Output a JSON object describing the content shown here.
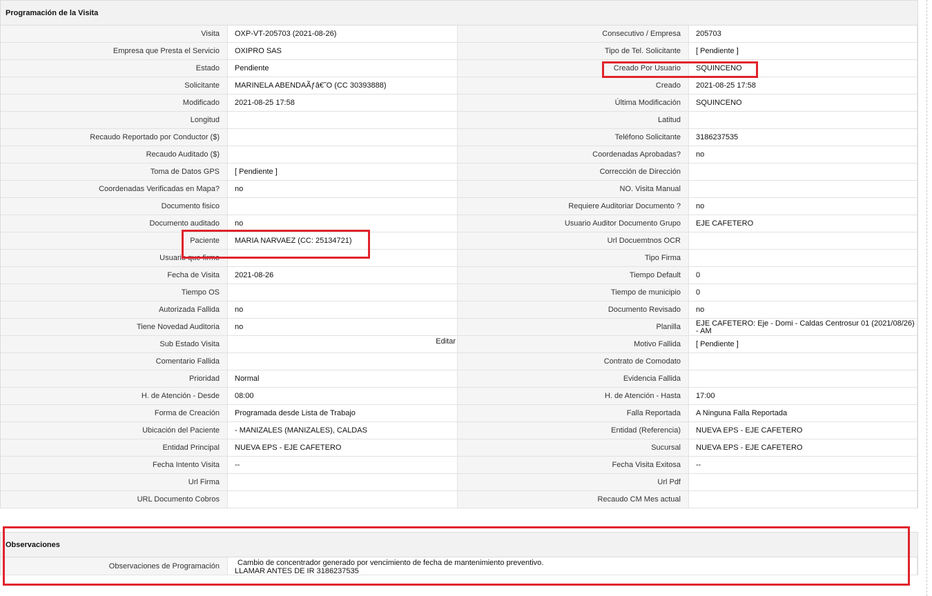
{
  "programacion": {
    "title": "Programación de la Visita",
    "rows": [
      {
        "l1": "Visita",
        "v1": "OXP-VT-205703 (2021-08-26)",
        "l2": "Consecutivo / Empresa",
        "v2": "205703"
      },
      {
        "l1": "Empresa que Presta el Servicio",
        "v1": "OXIPRO SAS",
        "l2": "Tipo de Tel. Solicitante",
        "v2": "[ Pendiente ]"
      },
      {
        "l1": "Estado",
        "v1": "Pendiente",
        "l2": "Creado Por Usuario",
        "v2": "SQUINCENO"
      },
      {
        "l1": "Solicitante",
        "v1": "MARINELA ABENDAÃƒâ€˜O (CC 30393888)",
        "l2": "Creado",
        "v2": "2021-08-25 17:58"
      },
      {
        "l1": "Modificado",
        "v1": "2021-08-25 17:58",
        "l2": "Última Modificación",
        "v2": " SQUINCENO"
      },
      {
        "l1": "Longitud",
        "v1": "",
        "l2": "Latitud",
        "v2": ""
      },
      {
        "l1": "Recaudo Reportado por Conductor ($)",
        "v1": "",
        "l2": "Teléfono Solicitante",
        "v2": "3186237535"
      },
      {
        "l1": "Recaudo Auditado ($)",
        "v1": "",
        "l2": "Coordenadas Aprobadas?",
        "v2": " no"
      },
      {
        "l1": "Toma de Datos GPS",
        "v1": "[ Pendiente ]",
        "l2": "Corrección de Dirección",
        "v2": ""
      },
      {
        "l1": "Coordenadas Verificadas en Mapa?",
        "v1": " no",
        "l2": "NO. Visita Manual",
        "v2": ""
      },
      {
        "l1": "Documento fisico",
        "v1": "",
        "l2": "Requiere Auditoriar Documento ?",
        "v2": " no"
      },
      {
        "l1": "Documento auditado",
        "v1": " no",
        "l2": "Usuario Auditor Documento Grupo",
        "v2": "EJE CAFETERO"
      },
      {
        "l1": "Paciente",
        "v1": "MARIA NARVAEZ (CC: 25134721)",
        "l2": "Url Docuemtnos OCR",
        "v2": ""
      },
      {
        "l1": "Usuario que firmo",
        "v1": "",
        "l2": "Tipo Firma",
        "v2": ""
      },
      {
        "l1": "Fecha de Visita",
        "v1": " 2021-08-26",
        "l2": "Tiempo Default",
        "v2": "0"
      },
      {
        "l1": "Tiempo OS",
        "v1": "",
        "l2": "Tiempo de municipio",
        "v2": "0"
      },
      {
        "l1": "Autorizada Fallida",
        "v1": " no",
        "l2": "Documento Revisado",
        "v2": " no"
      },
      {
        "l1": "Tiene Novedad Auditoria",
        "v1": " no",
        "l2": "Planilla",
        "v2": "EJE CAFETERO: Eje - Domi - Caldas Centrosur 01 (2021/08/26) - AM"
      },
      {
        "l1": "Sub Estado Visita",
        "v1": "",
        "l2": "Motivo Fallida",
        "v2": "[ Pendiente ]"
      },
      {
        "l1": "Comentario Fallida",
        "v1": "",
        "l2": "Contrato de Comodato",
        "v2": ""
      },
      {
        "l1": "Prioridad",
        "v1": "Normal",
        "l2": "Evidencia Fallida",
        "v2": ""
      },
      {
        "l1": "H. de Atención - Desde",
        "v1": "08:00",
        "l2": "H. de Atención - Hasta",
        "v2": " 17:00"
      },
      {
        "l1": "Forma de Creación",
        "v1": "Programada desde Lista de Trabajo",
        "l2": "Falla Reportada",
        "v2": "A Ninguna Falla Reportada"
      },
      {
        "l1": "Ubicación del Paciente",
        "v1": "- MANIZALES (MANIZALES), CALDAS",
        "l2": "Entidad (Referencia)",
        "v2": "NUEVA EPS - EJE CAFETERO"
      },
      {
        "l1": "Entidad Principal",
        "v1": "NUEVA EPS - EJE CAFETERO",
        "l2": "Sucursal",
        "v2": "NUEVA EPS - EJE CAFETERO"
      },
      {
        "l1": "Fecha Intento Visita",
        "v1": " --",
        "l2": "Fecha Visita Exitosa",
        "v2": " --"
      },
      {
        "l1": "Url Firma",
        "v1": "",
        "l2": "Url Pdf",
        "v2": ""
      },
      {
        "l1": "URL Documento Cobros",
        "v1": "",
        "l2": "Recaudo CM Mes actual",
        "v2": ""
      }
    ],
    "edit_label": "Editar"
  },
  "observaciones": {
    "title": "Observaciones",
    "label": "Observaciones de Programación",
    "line1": "Cambio de concentrador generado por vencimiento de fecha de mantenimiento preventivo.",
    "line2": "LLAMAR ANTES DE IR 3186237535"
  },
  "colors": {
    "highlight": "#e0232c",
    "label_bg": "#f5f5f5",
    "header_bg": "#f2f2f2"
  }
}
